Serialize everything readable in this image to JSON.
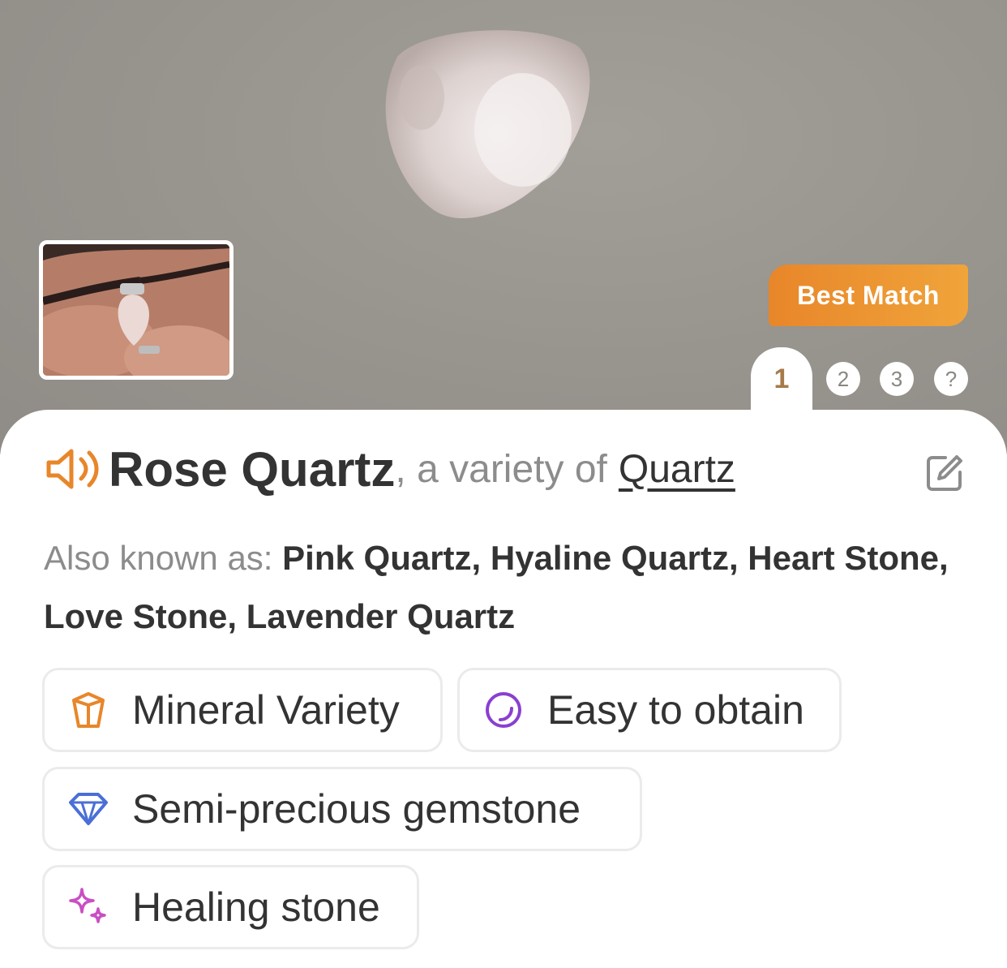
{
  "header": {
    "badge_label": "Best Match",
    "tabs": [
      {
        "label": "1",
        "active": true
      },
      {
        "label": "2",
        "active": false
      },
      {
        "label": "3",
        "active": false
      },
      {
        "label": "?",
        "active": false
      }
    ]
  },
  "result": {
    "name": "Rose Quartz",
    "variety_prefix": ", a variety of",
    "variety_link": "Quartz",
    "aka_label": "Also known as: ",
    "aka_values": "Pink Quartz, Hyaline Quartz, Heart Stone, Love Stone, Lavender Quartz"
  },
  "chips": [
    {
      "label": "Mineral Variety",
      "icon": "crystal-icon",
      "color": "#e8862a"
    },
    {
      "label": "Easy to obtain",
      "icon": "ring-icon",
      "color": "#8a3fd1"
    },
    {
      "label": "Semi-precious gemstone",
      "icon": "diamond-icon",
      "color": "#4a6fd6"
    },
    {
      "label": "Healing stone",
      "icon": "sparkle-icon",
      "color": "#c84fc4"
    }
  ],
  "colors": {
    "accent_orange": "#e8862a",
    "tab_active_text": "#a87a4a",
    "background_gray": "#99958f"
  }
}
